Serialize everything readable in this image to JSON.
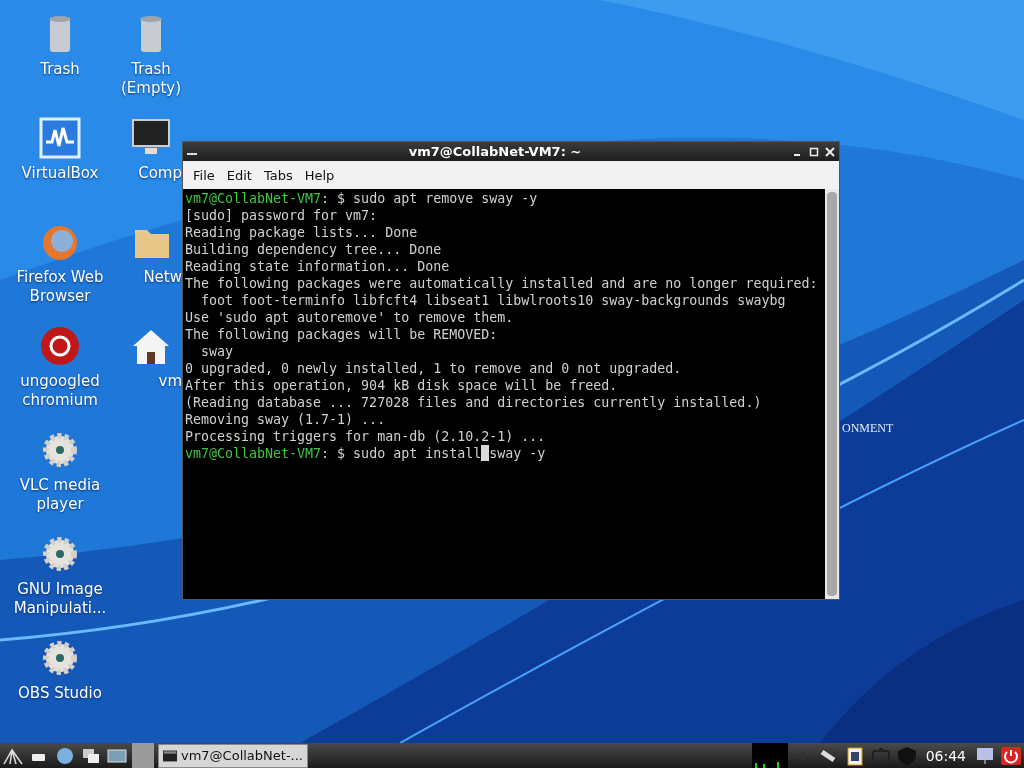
{
  "desktop_columns": [
    [
      {
        "label": "Trash"
      },
      {
        "label": "VirtualBox"
      },
      {
        "label": "Firefox Web Browser"
      },
      {
        "label": "ungoogled chromium"
      },
      {
        "label": "VLC media player"
      },
      {
        "label": "GNU Image Manipulati..."
      },
      {
        "label": "OBS Studio"
      }
    ],
    [
      {
        "label": "Trash (Empty)"
      },
      {
        "label": "Comp"
      },
      {
        "label": "Netw"
      },
      {
        "label": "vm"
      }
    ]
  ],
  "wallpaper_text": "ONMENT",
  "terminal": {
    "title": "vm7@CollabNet-VM7: ~",
    "menu": [
      "File",
      "Edit",
      "Tabs",
      "Help"
    ],
    "lines": [
      {
        "kind": "prompt",
        "prompt": "vm7@CollabNet-VM7",
        "text": ": $ sudo apt remove sway -y"
      },
      {
        "kind": "output",
        "text": "[sudo] password for vm7:"
      },
      {
        "kind": "output",
        "text": "Reading package lists... Done"
      },
      {
        "kind": "output",
        "text": "Building dependency tree... Done"
      },
      {
        "kind": "output",
        "text": "Reading state information... Done"
      },
      {
        "kind": "output",
        "text": "The following packages were automatically installed and are no longer required:"
      },
      {
        "kind": "output",
        "text": "  foot foot-terminfo libfcft4 libseat1 libwlroots10 sway-backgrounds swaybg"
      },
      {
        "kind": "output",
        "text": "Use 'sudo apt autoremove' to remove them."
      },
      {
        "kind": "output",
        "text": "The following packages will be REMOVED:"
      },
      {
        "kind": "output",
        "text": "  sway"
      },
      {
        "kind": "output",
        "text": "0 upgraded, 0 newly installed, 1 to remove and 0 not upgraded."
      },
      {
        "kind": "output",
        "text": "After this operation, 904 kB disk space will be freed."
      },
      {
        "kind": "output",
        "text": "(Reading database ... 727028 files and directories currently installed.)"
      },
      {
        "kind": "output",
        "text": "Removing sway (1.7-1) ..."
      },
      {
        "kind": "output",
        "text": "Processing triggers for man-db (2.10.2-1) ..."
      },
      {
        "kind": "prompt",
        "prompt": "vm7@CollabNet-VM7",
        "text": ": $ sudo apt install",
        "cursor": true,
        "after": "sway -y"
      }
    ]
  },
  "taskbar": {
    "task": "vm7@CollabNet-...",
    "clock": "06:44"
  }
}
